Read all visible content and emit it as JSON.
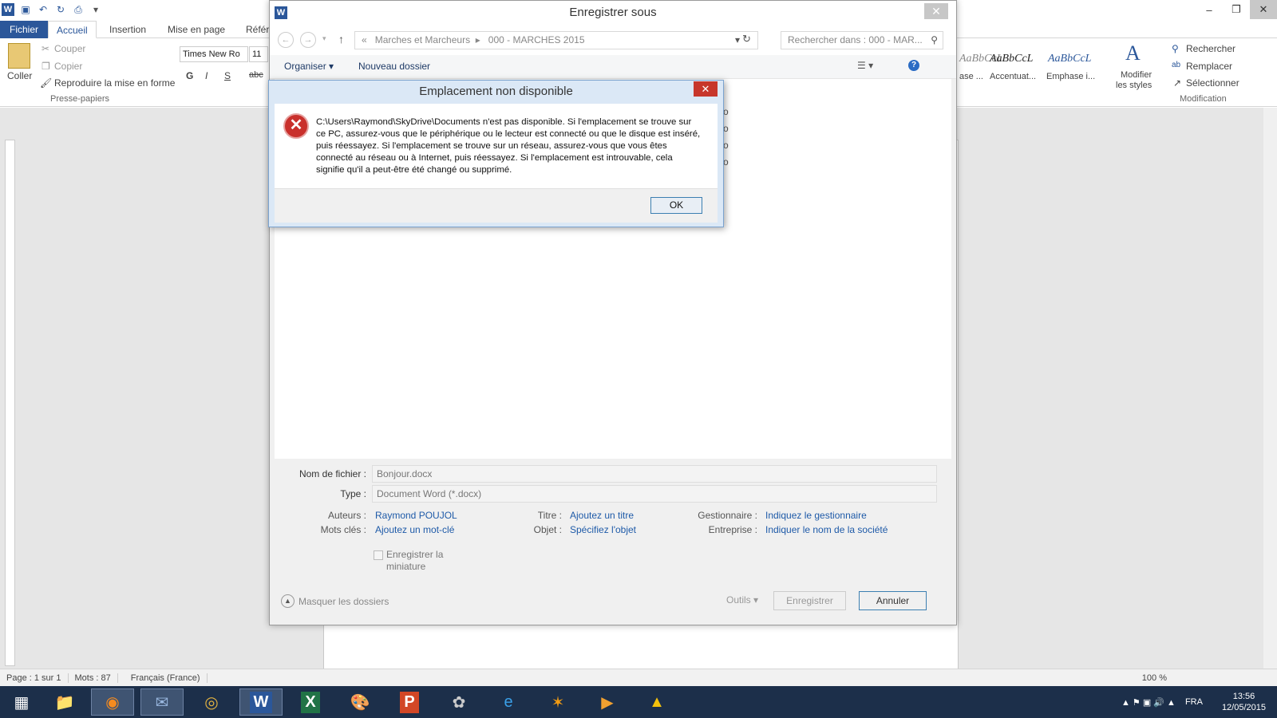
{
  "word": {
    "tabs": {
      "file": "Fichier",
      "home": "Accueil",
      "insert": "Insertion",
      "layout": "Mise en page",
      "refs": "Référ"
    },
    "clipboard": {
      "paste": "Coller",
      "cut": "Couper",
      "copy": "Copier",
      "format_painter": "Reproduire la mise en forme",
      "group": "Presse-papiers"
    },
    "font": {
      "name": "Times New Ro",
      "size": "11",
      "bold": "G",
      "italic": "I",
      "underline": "S",
      "strike": "abc"
    },
    "styles": [
      {
        "preview": "AaBbCcL",
        "label": "ase ..."
      },
      {
        "preview": "AaBbCcL",
        "label": "Accentuat..."
      },
      {
        "preview": "AaBbCcL",
        "label": "Emphase i..."
      }
    ],
    "modify_styles": [
      "Modifier",
      "les styles"
    ],
    "editing": {
      "find": "Rechercher",
      "replace": "Remplacer",
      "select": "Sélectionner",
      "group": "Modification"
    },
    "status": {
      "page": "Page : 1 sur 1",
      "words": "Mots : 87",
      "lang": "Français (France)",
      "zoom": "100 %"
    },
    "tray": {
      "lang": "FRA",
      "time": "13:56",
      "date": "12/05/2015"
    }
  },
  "save_dialog": {
    "title": "Enregistrer sous",
    "breadcrumb": {
      "sep": "«",
      "folder1": "Marches et Marcheurs",
      "folder2": "000 - MARCHES 2015"
    },
    "search_placeholder": "Rechercher dans : 000 - MAR...",
    "organize": "Organiser",
    "new_folder": "Nouveau dossier",
    "sizes": [
      "0 Ko",
      "3 Ko",
      "6 Ko",
      "9 Ko"
    ],
    "filename_label": "Nom de fichier :",
    "filename": "Bonjour.docx",
    "type_label": "Type :",
    "type": "Document Word (*.docx)",
    "authors_label": "Auteurs :",
    "authors": "Raymond POUJOL",
    "keywords_label": "Mots clés :",
    "keywords": "Ajoutez un mot-clé",
    "title_label": "Titre :",
    "title_val": "Ajoutez un titre",
    "subject_label": "Objet :",
    "subject": "Spécifiez l'objet",
    "manager_label": "Gestionnaire :",
    "manager": "Indiquez le gestionnaire",
    "company_label": "Entreprise :",
    "company": "Indiquer le nom de la société",
    "thumbnail": [
      "Enregistrer la",
      "miniature"
    ],
    "hide_folders": "Masquer les dossiers",
    "tools": "Outils",
    "save": "Enregistrer",
    "cancel": "Annuler"
  },
  "error_dialog": {
    "title": "Emplacement non disponible",
    "message_lines": [
      "C:\\Users\\Raymond\\SkyDrive\\Documents n'est pas disponible. Si l'emplacement se trouve sur",
      "ce PC, assurez-vous que le périphérique ou le lecteur est connecté ou que le disque est inséré,",
      "puis réessayez. Si l'emplacement se trouve sur un réseau, assurez-vous que vous êtes",
      "connecté au réseau ou à Internet, puis réessayez. Si l'emplacement est introuvable, cela",
      "signifie qu'il a peut-être été changé ou supprimé."
    ],
    "ok": "OK"
  },
  "colors": {
    "word_blue": "#2b579a",
    "taskbar": "#1c2f4a",
    "error_red": "#c9302c",
    "link": "#1e5aa8"
  },
  "icons": [
    "word-icon",
    "save-icon",
    "undo-icon",
    "redo-icon",
    "print-icon",
    "paste-icon",
    "scissors-icon",
    "copy-icon",
    "brush-icon",
    "find-icon",
    "replace-icon",
    "select-icon",
    "error-icon",
    "refresh-icon",
    "search-icon",
    "help-icon",
    "view-icon"
  ]
}
